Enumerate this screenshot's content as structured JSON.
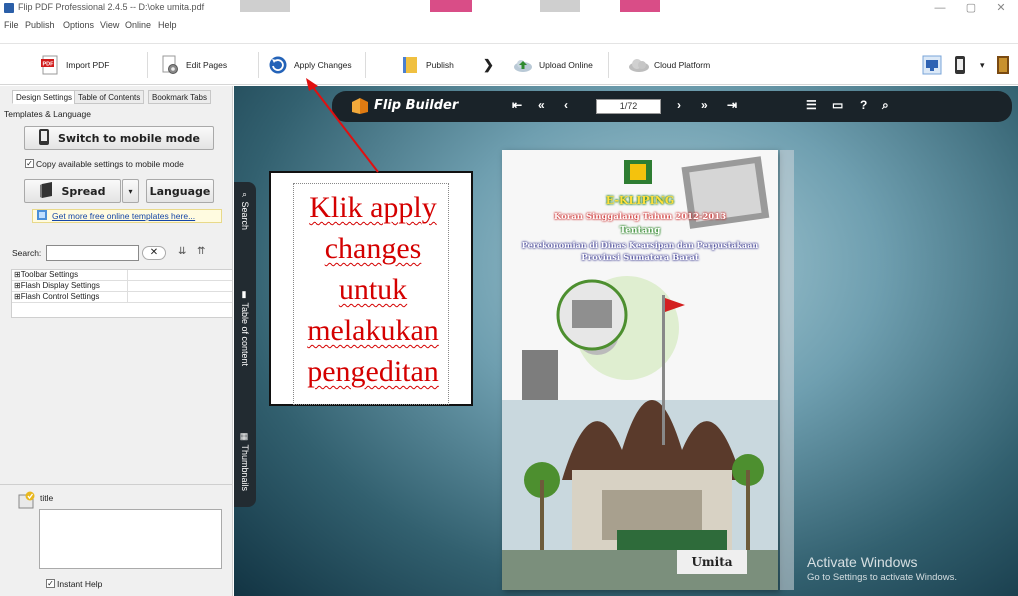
{
  "window": {
    "title": "Flip PDF Professional 2.4.5  -- D:\\oke umita.pdf",
    "controls": {
      "minimize": "—",
      "restore": "▢",
      "close": "✕"
    }
  },
  "menu": [
    "File",
    "Publish",
    "Options",
    "View",
    "Online",
    "Help"
  ],
  "toolbar": {
    "import_pdf": "Import PDF",
    "edit_pages": "Edit Pages",
    "apply_changes": "Apply Changes",
    "publish": "Publish",
    "upload_online": "Upload Online",
    "cloud_platform": "Cloud Platform",
    "next_arrow": "❯",
    "view_dropdown": "▾"
  },
  "left_panel": {
    "tabs": [
      "Design Settings",
      "Table of Contents",
      "Bookmark Tabs"
    ],
    "group_title": "Templates & Language",
    "switch_mobile": "Switch to mobile mode",
    "copy_settings_label": "Copy available settings to mobile mode",
    "copy_settings_checked": true,
    "spread": "Spread",
    "language": "Language",
    "more_templates": "Get more free online templates here...",
    "search_label": "Search:",
    "search_value": "",
    "clear_glyph": "✕",
    "tree_rows": [
      "⊞Toolbar Settings",
      "⊞Flash Display Settings",
      "⊞Flash Control Settings"
    ],
    "help_title": "title",
    "instant_help": "Instant Help",
    "instant_help_checked": true
  },
  "viewer": {
    "brand": "Flip Builder",
    "page_indicator": "1/72",
    "side_tabs": [
      "Search",
      "Table of content",
      "Thumbnails"
    ],
    "nav": {
      "first": "⇤",
      "prev2": "«",
      "prev": "‹",
      "next": "›",
      "next2": "»",
      "last": "⇥"
    },
    "tools": {
      "toc": "☰",
      "screen": "▭",
      "help": "?",
      "zoom": "⌕"
    }
  },
  "book_cover": {
    "title": "E-KLIPING",
    "line1": "Koran Singgalang Tahun 2012-2013",
    "line2": "Tentang",
    "line3": "Perekonomian di Dinas Kearsipan dan Perpustakaan",
    "line4": "Provinsi Sumatera Barat",
    "footer": "Umita"
  },
  "annotation": {
    "lines": [
      "Klik apply",
      "changes",
      "untuk",
      "melakukan",
      "pengeditan"
    ]
  },
  "watermark": {
    "line1": "Activate Windows",
    "line2": "Go to Settings to activate Windows."
  }
}
